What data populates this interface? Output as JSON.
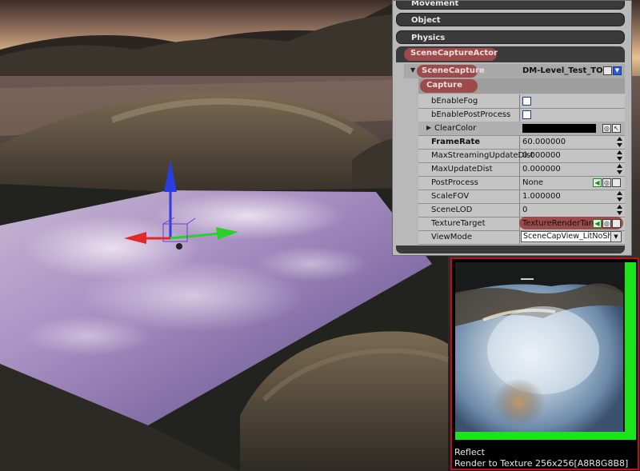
{
  "properties_panel": {
    "categories": [
      {
        "label": "Movement"
      },
      {
        "label": "Object"
      },
      {
        "label": "Physics"
      }
    ],
    "actor_section": {
      "label": "SceneCaptureActor"
    },
    "component": {
      "label": "SceneCapture",
      "value": "DM-Level_Test_TOS"
    },
    "subcategory": {
      "label": "Capture"
    },
    "rows": [
      {
        "name": "bEnableFog",
        "value": "",
        "widget": "checkbox"
      },
      {
        "name": "bEnablePostProcess",
        "value": "",
        "widget": "checkbox"
      },
      {
        "name": "ClearColor",
        "value": "",
        "widget": "color"
      },
      {
        "name": "FrameRate",
        "value": "60.000000",
        "widget": "spinner"
      },
      {
        "name": "MaxStreamingUpdateDist",
        "value": "0.000000",
        "widget": "spinner"
      },
      {
        "name": "MaxUpdateDist",
        "value": "0.000000",
        "widget": "spinner"
      },
      {
        "name": "PostProcess",
        "value": "None",
        "widget": "asset"
      },
      {
        "name": "ScaleFOV",
        "value": "1.000000",
        "widget": "spinner"
      },
      {
        "name": "SceneLOD",
        "value": "0",
        "widget": "spinner"
      },
      {
        "name": "TextureTarget",
        "value": "TextureRenderTarge",
        "widget": "asset"
      },
      {
        "name": "ViewMode",
        "value": "SceneCapView_LitNoShac",
        "widget": "dropdown"
      }
    ]
  },
  "render_target_preview": {
    "name": "Reflect",
    "info": "Render to Texture 256x256[A8R8G8B8]"
  },
  "colors": {
    "highlight_pill": "#9c4a4a",
    "category_bar": "#3a3a3a",
    "panel_bg": "#b9b9b9",
    "preview_border": "#b4141a",
    "preview_green_bar": "#19e519",
    "gizmo_z": "#2a3ee0",
    "gizmo_x": "#e02a2a",
    "gizmo_y": "#2ad12a"
  }
}
